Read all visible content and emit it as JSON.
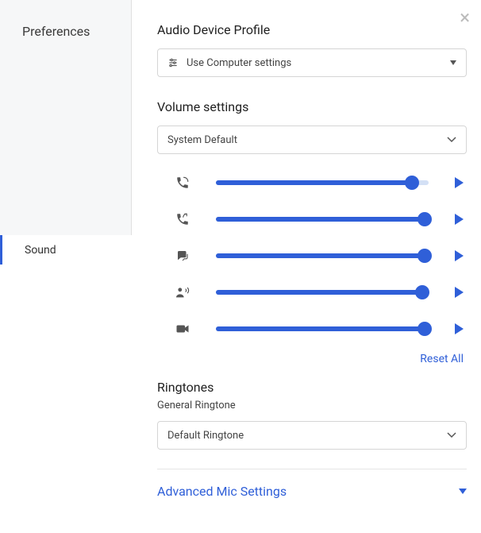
{
  "sidebar": {
    "title": "Preferences",
    "active_item": "Sound"
  },
  "audio_profile": {
    "title": "Audio Device Profile",
    "selected": "Use Computer settings"
  },
  "volume": {
    "title": "Volume settings",
    "device_selected": "System Default",
    "sliders": [
      {
        "icon": "phone-ring-icon",
        "value": 92
      },
      {
        "icon": "phone-return-icon",
        "value": 98
      },
      {
        "icon": "chat-icon",
        "value": 98
      },
      {
        "icon": "person-sound-icon",
        "value": 97
      },
      {
        "icon": "video-icon",
        "value": 98
      }
    ],
    "reset_label": "Reset All"
  },
  "ringtones": {
    "title": "Ringtones",
    "subtitle": "General Ringtone",
    "selected": "Default Ringtone"
  },
  "advanced": {
    "label": "Advanced Mic Settings"
  }
}
